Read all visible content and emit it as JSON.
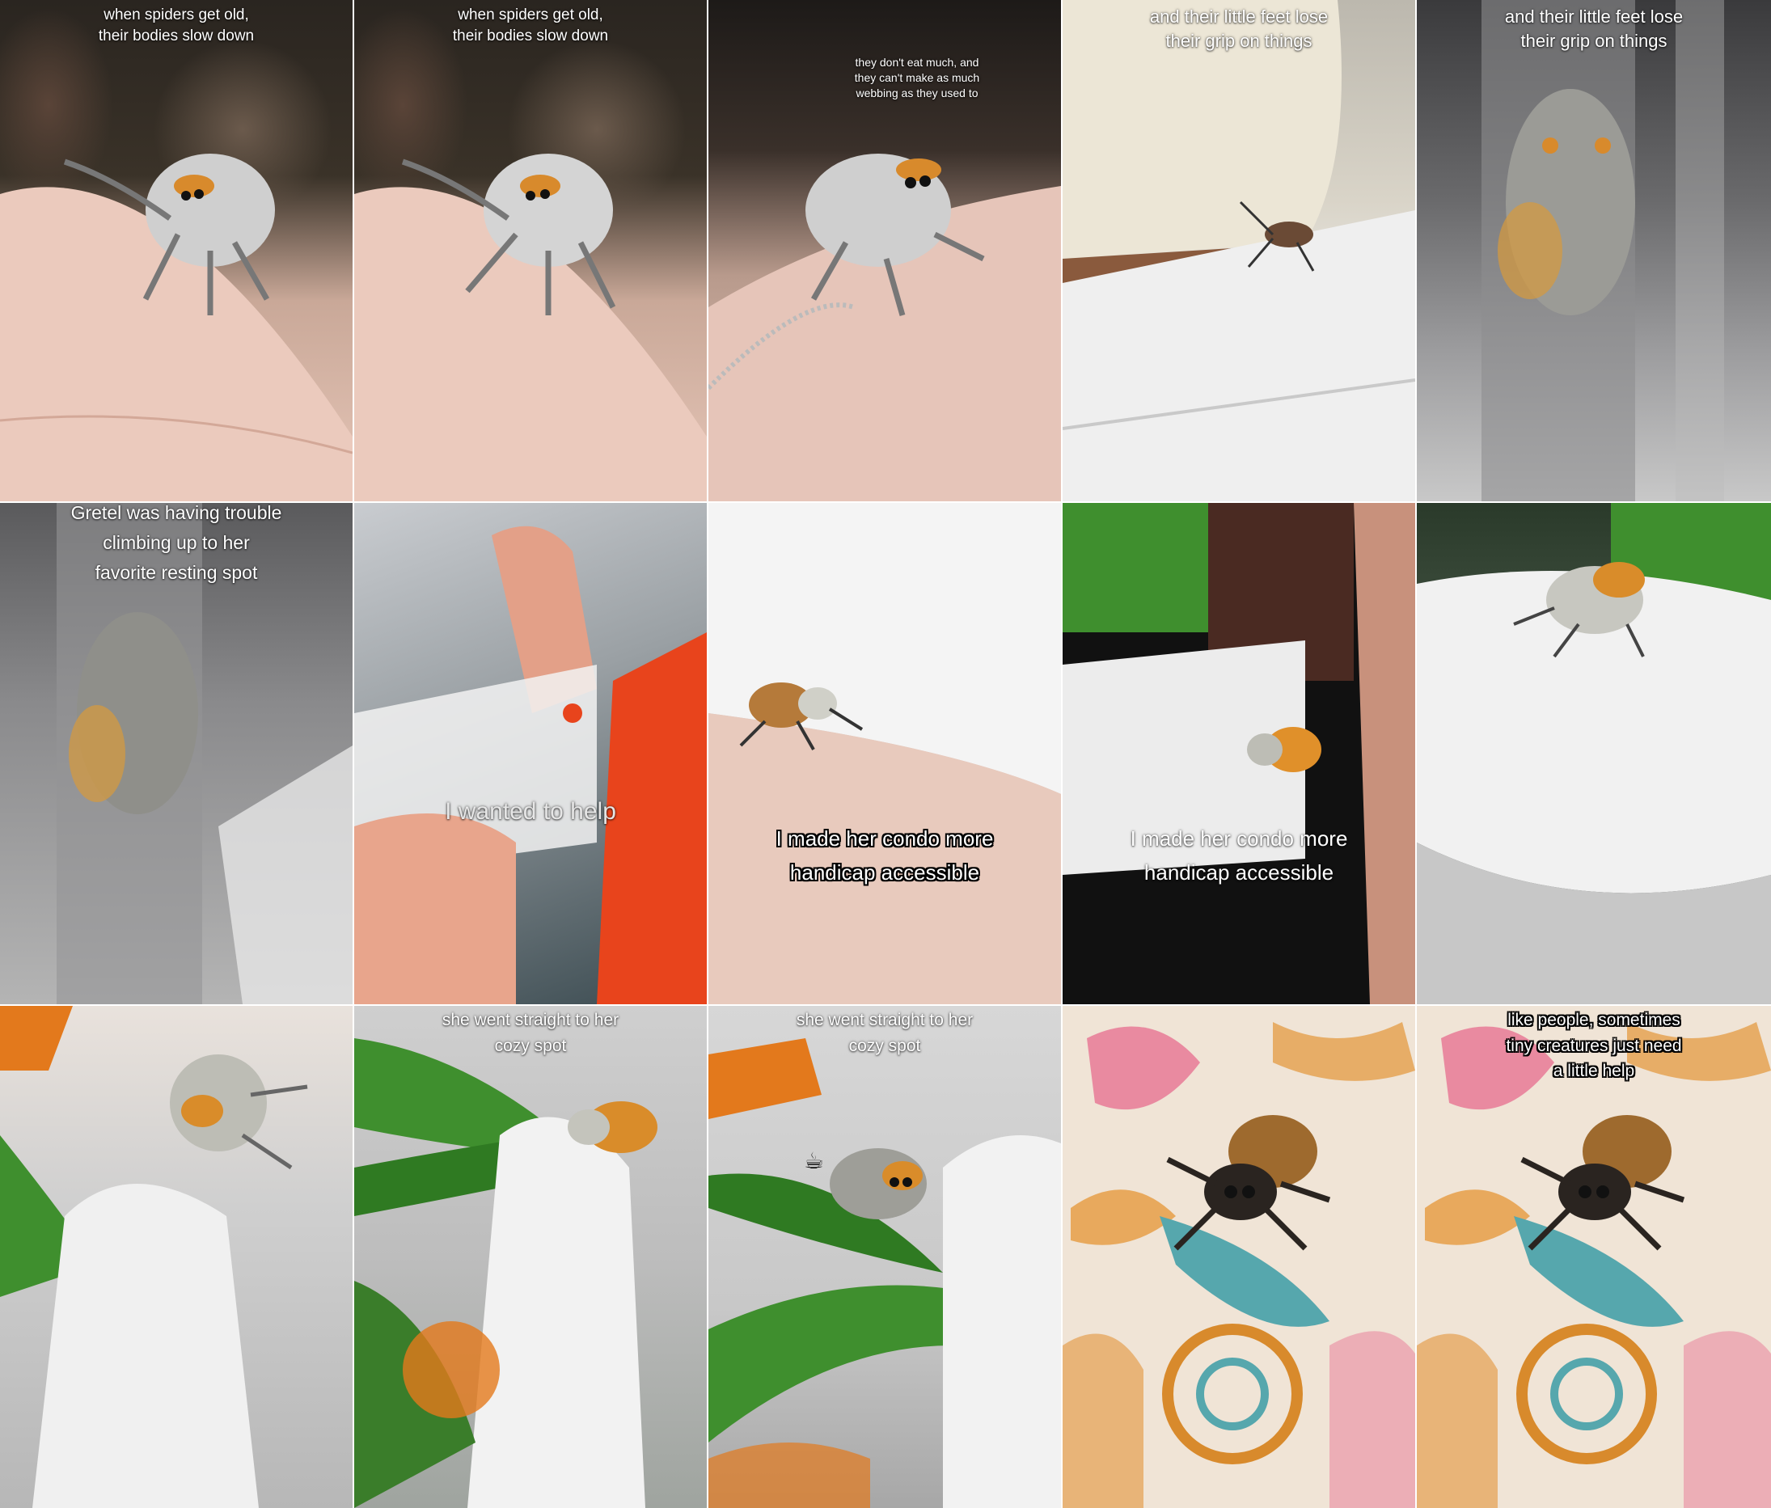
{
  "frames": [
    {
      "caption": "when spiders get old,\ntheir bodies slow down",
      "scene": "hand"
    },
    {
      "caption": "when spiders get old,\ntheir bodies slow down",
      "scene": "hand"
    },
    {
      "caption": "they don't eat much, and\nthey can't make as much\nwebbing as they used to",
      "scene": "finger"
    },
    {
      "caption": "and their little feet lose\ntheir grip on things",
      "scene": "shelf"
    },
    {
      "caption": "and their little feet lose\ntheir grip on things",
      "scene": "glass"
    },
    {
      "caption": "Gretel was having trouble\nclimbing up to her\nfavorite resting spot",
      "scene": "glass2"
    },
    {
      "caption": "I wanted to help",
      "scene": "scissors"
    },
    {
      "caption": "I made her condo more\nhandicap accessible",
      "scene": "mesh-hand"
    },
    {
      "caption": "I made her condo more\nhandicap accessible",
      "scene": "mesh-dark"
    },
    {
      "caption": "",
      "scene": "mesh-green"
    },
    {
      "caption": "",
      "scene": "mesh-cone"
    },
    {
      "caption": "she went straight to her\ncozy spot",
      "scene": "leaf"
    },
    {
      "caption": "she went straight to her\ncozy spot",
      "scene": "leaf2",
      "emoji": "☕"
    },
    {
      "caption": "",
      "scene": "tattoo"
    },
    {
      "caption": "like people, sometimes\ntiny creatures just need\na little help",
      "scene": "tattoo"
    }
  ],
  "colors": {
    "skin": "#e8c9bd",
    "mesh": "#f2f2f2",
    "leaf": "#3f8f2e",
    "orange": "#e3791c",
    "dark": "#141414"
  }
}
